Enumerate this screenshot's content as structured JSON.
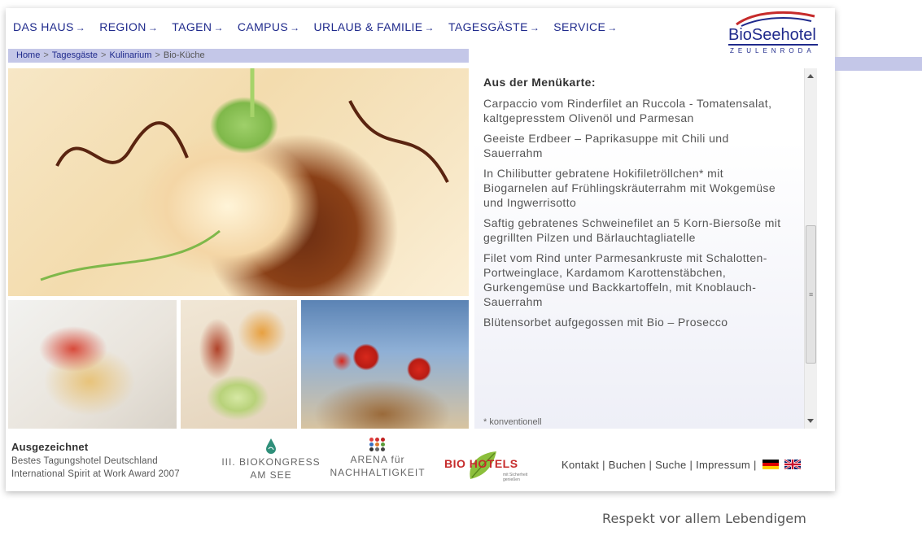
{
  "nav": {
    "items": [
      {
        "label": "DAS HAUS",
        "arrow": "→"
      },
      {
        "label": "REGION",
        "arrow": "→"
      },
      {
        "label": "TAGEN",
        "arrow": "→"
      },
      {
        "label": "CAMPUS",
        "arrow": "→"
      },
      {
        "label": "URLAUB & FAMILIE",
        "arrow": "→"
      },
      {
        "label": "TAGESGÄSTE",
        "arrow": "→"
      },
      {
        "label": "SERVICE",
        "arrow": "→"
      }
    ]
  },
  "logo": {
    "name": "BioSeehotel",
    "city": "ZEULENRODA"
  },
  "breadcrumb": {
    "items": [
      "Home",
      "Tagesgäste",
      "Kulinarium"
    ],
    "separator": ">",
    "current": "Bio-Küche"
  },
  "menu": {
    "heading": "Aus der Menükarte:",
    "dishes": [
      "Carpaccio vom Rinderfilet an Ruccola - Tomatensalat, kaltgepresstem Olivenöl und Parmesan",
      "Geeiste Erdbeer – Paprikasuppe mit Chili und Sauerrahm",
      "In Chilibutter gebratene Hokifiletröllchen* mit Biogarnelen auf Frühlingskräuterrahm mit Wokgemüse und Ingwerrisotto",
      "Saftig gebratenes Schweinefilet an 5 Korn-Biersoße mit gegrillten Pilzen und Bärlauchtagliatelle",
      "Filet vom Rind unter Parmesankruste mit Schalotten- Portweinglace, Kardamom Karottenstäbchen, Gurkengemüse und Backkartoffeln, mit Knoblauch-Sauerrahm",
      "Blütensorbet aufgegossen mit Bio – Prosecco"
    ],
    "footnote": "* konventionell"
  },
  "footer": {
    "award_title": "Ausgezeichnet",
    "award_line1": "Bestes Tagungshotel Deutschland",
    "award_line2": "International Spirit at Work Award 2007",
    "biokongress_line1": "III. BIOKONGRESS",
    "biokongress_line2": "AM SEE",
    "arena_line1": "ARENA für",
    "arena_line2": "NACHHALTIGKEIT",
    "biohotels": "BIO HOTELS",
    "biohotels_sub": "mit Sicherheit genießen",
    "links": [
      "Kontakt",
      "Buchen",
      "Suche",
      "Impressum"
    ],
    "link_sep": "|"
  },
  "tagline": "Respekt vor allem Lebendigem",
  "colors": {
    "nav": "#1f2a8c",
    "breadcrumb_bar": "#c4c7e8",
    "biohotels_red": "#c62b2b"
  },
  "icons": [
    "arrow-right-icon",
    "german-flag-icon",
    "uk-flag-icon",
    "bioseehotel-logo-swoosh",
    "biokongress-drop-icon",
    "arena-dots-icon",
    "biohotels-leaf-icon"
  ]
}
